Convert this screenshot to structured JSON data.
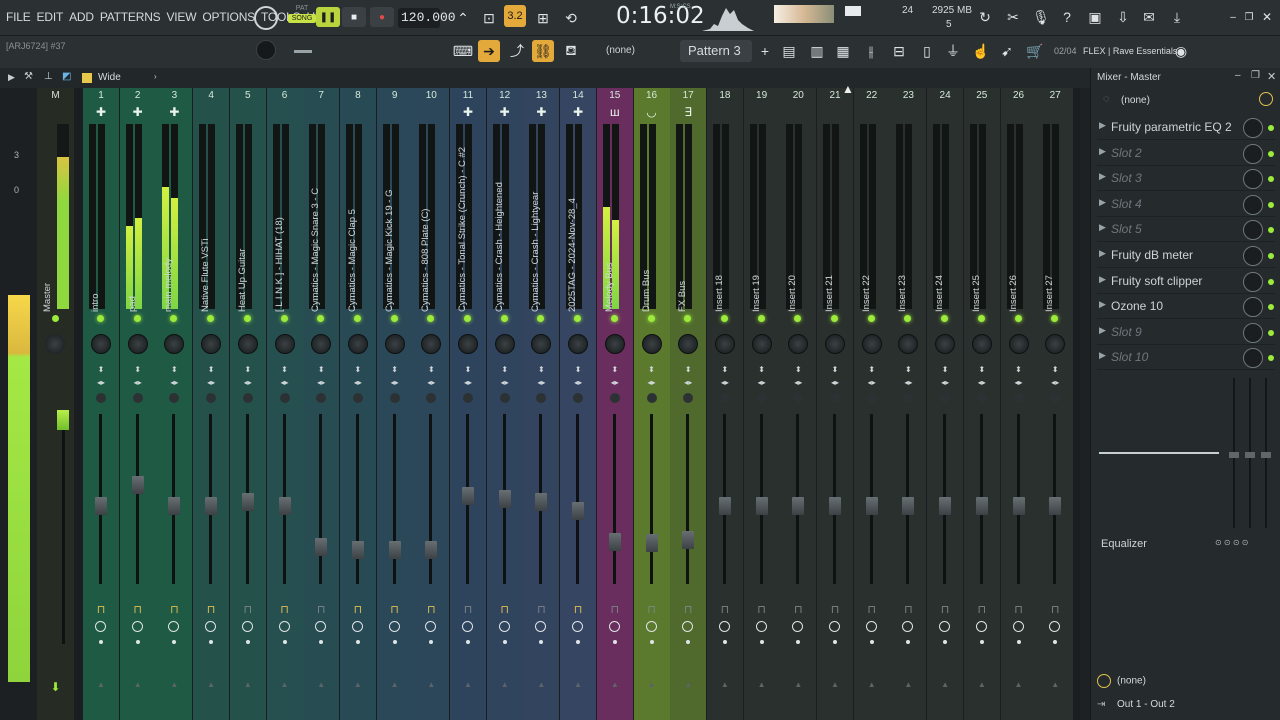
{
  "menu": [
    "FILE",
    "EDIT",
    "ADD",
    "PATTERNS",
    "VIEW",
    "OPTIONS",
    "TOOLS",
    "HELP"
  ],
  "hint": "[ARJ6724] #37",
  "pat_song": {
    "pat": "PAT",
    "song": "SONG"
  },
  "tempo": "120.000",
  "time": "0:16:02",
  "time_label": "M:S:CS",
  "cpu": "24",
  "memory": "2925 MB",
  "voices": "5",
  "pattern": "Pattern 3",
  "snap": "(none)",
  "song_info": "02/04",
  "song_name": "FLEX | Rave Essentials",
  "view_label": "Wide",
  "toolbar_icons": [
    "keyboard-icon",
    "arrow-right-icon",
    "curve-icon",
    "link-icon",
    "stamp-icon"
  ],
  "mixer": {
    "master": {
      "num": "M",
      "name": "Master",
      "scale_top": "3",
      "scale_mid": "0"
    },
    "strips": [
      {
        "num": "1",
        "name": "intro",
        "color": "#1f5a45",
        "meter": [
          0,
          0
        ],
        "fader": 0.46,
        "bot": "gold"
      },
      {
        "num": "2",
        "name": "pad",
        "color": "#1f5a45",
        "meter": [
          45,
          49
        ],
        "fader": 0.58,
        "bot": "gold"
      },
      {
        "num": "3",
        "name": "main melody",
        "color": "#1f5a45",
        "meter": [
          66,
          60
        ],
        "fader": 0.46,
        "bot": "gold"
      },
      {
        "num": "4",
        "name": "Native Flute VSTi",
        "color": "#24524a",
        "meter": [
          0,
          0
        ],
        "fader": 0.46,
        "bot": "gold"
      },
      {
        "num": "5",
        "name": "Heat Up Guitar",
        "color": "#24524a",
        "meter": [
          0,
          0
        ],
        "fader": 0.48,
        "bot": "gray"
      },
      {
        "num": "6",
        "name": "[ L I N K ] - HIHAT (18)",
        "color": "#26504f",
        "meter": [
          0,
          0
        ],
        "fader": 0.46,
        "bot": "gold"
      },
      {
        "num": "7",
        "name": "Cymatics - Magic Snare 3 - C",
        "color": "#274c52",
        "meter": [
          0,
          0
        ],
        "fader": 0.22,
        "bot": "gray"
      },
      {
        "num": "8",
        "name": "Cymatics - Magic Clap 5",
        "color": "#284a55",
        "meter": [
          0,
          0
        ],
        "fader": 0.2,
        "bot": "gold"
      },
      {
        "num": "9",
        "name": "Cymatics - Magic Kick 19 - G",
        "color": "#2a4858",
        "meter": [
          0,
          0
        ],
        "fader": 0.2,
        "bot": "gold"
      },
      {
        "num": "10",
        "name": "Cymatics - 808 Plate (C)",
        "color": "#2c465a",
        "meter": [
          0,
          0
        ],
        "fader": 0.2,
        "bot": "gold"
      },
      {
        "num": "11",
        "name": "Cymatics - Tonal Strike (Crunch) - C #2",
        "color": "#2e445c",
        "meter": [
          0,
          0
        ],
        "fader": 0.52,
        "bot": "gray"
      },
      {
        "num": "12",
        "name": "Cymatics - Crash - Heightened",
        "color": "#30445e",
        "meter": [
          0,
          0
        ],
        "fader": 0.5,
        "bot": "gold"
      },
      {
        "num": "13",
        "name": "Cymatics - Crash - Lightyear",
        "color": "#33445f",
        "meter": [
          0,
          0
        ],
        "fader": 0.48,
        "bot": "gray"
      },
      {
        "num": "14",
        "name": "2025TAG - 2024-Nov-28_4",
        "color": "#364561",
        "meter": [
          0,
          0
        ],
        "fader": 0.43,
        "bot": "gold"
      },
      {
        "num": "15",
        "name": "Melody Bus",
        "color": "#6a2e5e",
        "meter": [
          55,
          48
        ],
        "fader": 0.25,
        "bot": "gray"
      },
      {
        "num": "16",
        "name": "Drum Bus",
        "color": "#5c7a2e",
        "meter": [
          0,
          0
        ],
        "fader": 0.24,
        "bot": "gray"
      },
      {
        "num": "17",
        "name": "FX Bus",
        "color": "#4f6a2c",
        "meter": [
          0,
          0
        ],
        "fader": 0.26,
        "bot": "gray"
      },
      {
        "num": "18",
        "name": "Insert 18",
        "color": "#2a302d",
        "meter": [
          0,
          0
        ],
        "fader": 0.46,
        "bot": "gray"
      },
      {
        "num": "19",
        "name": "Insert 19",
        "color": "#2a302d",
        "meter": [
          0,
          0
        ],
        "fader": 0.46,
        "bot": "gray"
      },
      {
        "num": "20",
        "name": "Insert 20",
        "color": "#2a302d",
        "meter": [
          0,
          0
        ],
        "fader": 0.46,
        "bot": "gray"
      },
      {
        "num": "21",
        "name": "Insert 21",
        "color": "#2a302d",
        "meter": [
          0,
          0
        ],
        "fader": 0.46,
        "bot": "gray"
      },
      {
        "num": "22",
        "name": "Insert 22",
        "color": "#2a302d",
        "meter": [
          0,
          0
        ],
        "fader": 0.46,
        "bot": "gray"
      },
      {
        "num": "23",
        "name": "Insert 23",
        "color": "#2a302d",
        "meter": [
          0,
          0
        ],
        "fader": 0.46,
        "bot": "gray"
      },
      {
        "num": "24",
        "name": "Insert 24",
        "color": "#2a302d",
        "meter": [
          0,
          0
        ],
        "fader": 0.46,
        "bot": "gray"
      },
      {
        "num": "25",
        "name": "Insert 25",
        "color": "#2a302d",
        "meter": [
          0,
          0
        ],
        "fader": 0.46,
        "bot": "gray"
      },
      {
        "num": "26",
        "name": "Insert 26",
        "color": "#2a302d",
        "meter": [
          0,
          0
        ],
        "fader": 0.46,
        "bot": "gray"
      },
      {
        "num": "27",
        "name": "Insert 27",
        "color": "#2a302d",
        "meter": [
          0,
          0
        ],
        "fader": 0.46,
        "bot": "gray"
      }
    ]
  },
  "panel": {
    "title": "Mixer - Master",
    "input": "(none)",
    "slots": [
      {
        "name": "Fruity parametric EQ 2",
        "active": true
      },
      {
        "name": "Slot 2",
        "active": false
      },
      {
        "name": "Slot 3",
        "active": false
      },
      {
        "name": "Slot 4",
        "active": false
      },
      {
        "name": "Slot 5",
        "active": false
      },
      {
        "name": "Fruity dB meter",
        "active": true
      },
      {
        "name": "Fruity soft clipper",
        "active": true
      },
      {
        "name": "Ozone 10",
        "active": true
      },
      {
        "name": "Slot 9",
        "active": false
      },
      {
        "name": "Slot 10",
        "active": false
      }
    ],
    "eq_label": "Equalizer",
    "output_none": "(none)",
    "output": "Out 1 - Out 2"
  }
}
